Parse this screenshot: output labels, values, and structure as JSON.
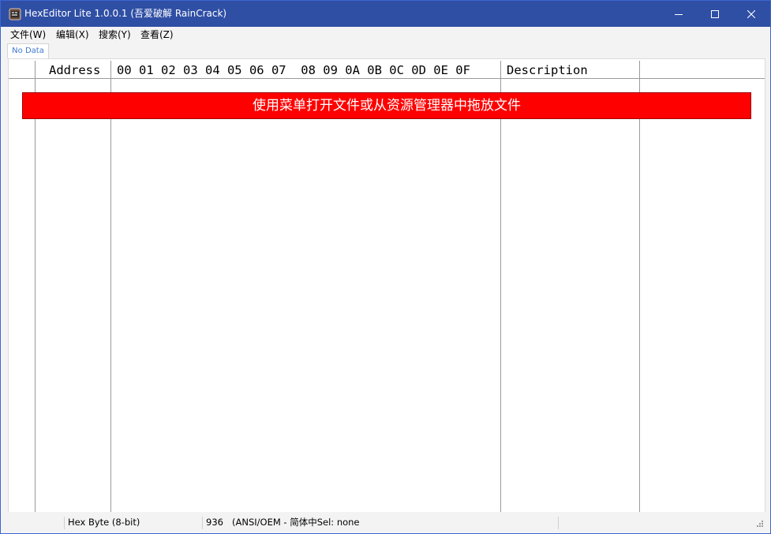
{
  "window": {
    "title": "HexEditor Lite 1.0.0.1 (吾爱破解 RainCrack)",
    "controls": {
      "minimize": "minimize-icon",
      "maximize": "maximize-icon",
      "close": "close-icon"
    }
  },
  "menu": [
    {
      "label": "文件(W)"
    },
    {
      "label": "编辑(X)"
    },
    {
      "label": "搜索(Y)"
    },
    {
      "label": "查看(Z)"
    }
  ],
  "tabs": [
    {
      "label": "No Data"
    }
  ],
  "grid": {
    "headers": {
      "address": "Address",
      "bytes": "00 01 02 03 04 05 06 07  08 09 0A 0B 0C 0D 0E 0F",
      "description": "Description"
    }
  },
  "banner": {
    "text": "使用菜单打开文件或从资源管理器中拖放文件"
  },
  "status": {
    "cells": [
      "",
      "Hex Byte (8-bit)",
      "936",
      "(ANSI/OEM - 简体中Sel: none"
    ]
  },
  "colors": {
    "titlebar": "#2f4fa5",
    "banner": "#fe0000",
    "tab_text": "#3d78d1"
  }
}
